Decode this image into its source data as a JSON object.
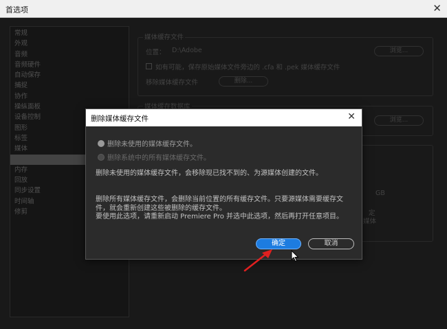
{
  "window": {
    "title": "首选项",
    "close_glyph": "✕"
  },
  "sidebar": {
    "items": [
      {
        "label": "常规",
        "selected": false
      },
      {
        "label": "外观",
        "selected": false
      },
      {
        "label": "音频",
        "selected": false
      },
      {
        "label": "音频硬件",
        "selected": false
      },
      {
        "label": "自动保存",
        "selected": false
      },
      {
        "label": "捕捉",
        "selected": false
      },
      {
        "label": "协作",
        "selected": false
      },
      {
        "label": "操纵面板",
        "selected": false
      },
      {
        "label": "设备控制",
        "selected": false
      },
      {
        "label": "图形",
        "selected": false
      },
      {
        "label": "标签",
        "selected": false
      },
      {
        "label": "媒体",
        "selected": false
      },
      {
        "label": "",
        "selected": true
      },
      {
        "label": "内存",
        "selected": false
      },
      {
        "label": "回放",
        "selected": false
      },
      {
        "label": "同步设置",
        "selected": false
      },
      {
        "label": "时间轴",
        "selected": false
      },
      {
        "label": "修剪",
        "selected": false
      }
    ]
  },
  "media_cache_files": {
    "heading": "媒体缓存文件",
    "location_label": "位置：",
    "location_value": "D:\\Adobe",
    "browse_label": "浏览...",
    "checkbox_label": "如有可能，保存原始媒体文件旁边的 .cfa 和 .pek 媒体缓存文件",
    "remove_label": "移除媒体缓存文件",
    "delete_button": "删除..."
  },
  "media_cache_db": {
    "heading": "媒体缓存数据库",
    "browse_label": "浏览..."
  },
  "background": {
    "gb_label": "GB",
    "partial_1": "定",
    "partial_2": "媒体"
  },
  "dialog": {
    "title": "删除媒体缓存文件",
    "close_glyph": "✕",
    "option_unused": "删除未使用的媒体缓存文件。",
    "option_all": "删除系统中的所有媒体缓存文件。",
    "desc_unused": "删除未使用的媒体缓存文件，会移除现已找不到的、为源媒体创建的文件。",
    "desc_all": "删除所有媒体缓存文件，会删除当前位置的所有缓存文件。只要源媒体需要缓存文件，就会重新创建这些被删除的缓存文件。\n要使用此选项，请重新启动 Premiere Pro 并选中此选项，然后再打开任意项目。",
    "ok_label": "确定",
    "cancel_label": "取消",
    "selected_option": "option_unused"
  },
  "colors": {
    "accent": "#1d7ce0",
    "annotation_arrow": "#e02020"
  },
  "icons": [
    "close-icon",
    "radio-selected-icon",
    "radio-disabled-icon",
    "mouse-cursor-icon",
    "annotation-arrow-icon"
  ]
}
